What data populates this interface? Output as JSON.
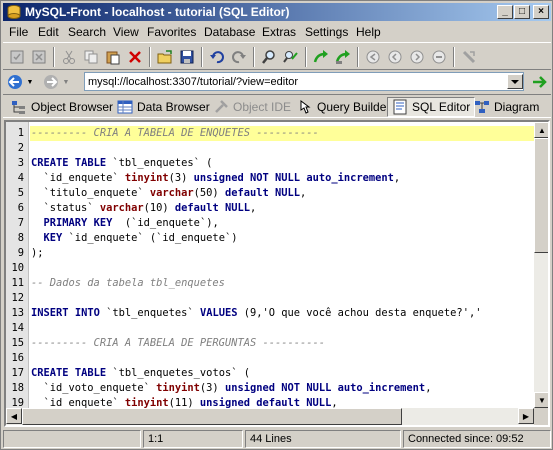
{
  "window": {
    "title": "MySQL-Front - localhost - tutorial  (SQL Editor)"
  },
  "menu": [
    "File",
    "Edit",
    "Search",
    "View",
    "Favorites",
    "Database",
    "Extras",
    "Settings",
    "Help"
  ],
  "address": {
    "value": "mysql://localhost:3307/tutorial/?view=editor"
  },
  "views": {
    "object_browser": "Object Browser",
    "data_browser": "Data Browser",
    "object_ide": "Object IDE",
    "query_builder": "Query Builder",
    "sql_editor": "SQL Editor",
    "diagram": "Diagram"
  },
  "editor": {
    "lines": [
      "--------- CRIA A TABELA DE ENQUETES ----------",
      "",
      "CREATE TABLE `tbl_enquetes` (",
      "  `id_enquete` tinyint(3) unsigned NOT NULL auto_increment,",
      "  `titulo_enquete` varchar(50) default NULL,",
      "  `status` varchar(10) default NULL,",
      "  PRIMARY KEY  (`id_enquete`),",
      "  KEY `id_enquete` (`id_enquete`)",
      ");",
      "",
      "-- Dados da tabela tbl_enquetes",
      "",
      "INSERT INTO `tbl_enquetes` VALUES (9,'O que você achou desta enquete?','",
      "",
      "--------- CRIA A TABELA DE PERGUNTAS ----------",
      "",
      "CREATE TABLE `tbl_enquetes_votos` (",
      "  `id_voto_enquete` tinyint(3) unsigned NOT NULL auto_increment,",
      "  `id_enquete` tinyint(11) unsigned default NULL,"
    ],
    "numbers": [
      "1",
      "2",
      "3",
      "4",
      "5",
      "6",
      "7",
      "8",
      "9",
      "10",
      "11",
      "12",
      "13",
      "14",
      "15",
      "16",
      "17",
      "18",
      "19"
    ]
  },
  "status": {
    "position": "1:1",
    "lines": "44 Lines",
    "connected": "Connected since: 09:52"
  },
  "colors": {
    "keyword": "#000080",
    "type": "#800000",
    "comment": "#808080",
    "highlight": "#ffff99"
  },
  "icons": [
    "app-icon",
    "new-icon",
    "close-icon",
    "cut-icon",
    "copy-icon",
    "paste-icon",
    "delete-icon",
    "open-icon",
    "save-icon",
    "undo-icon",
    "redo-icon",
    "find-icon",
    "replace-icon",
    "run-icon",
    "run-selection-icon",
    "first-icon",
    "prev-icon",
    "next-icon",
    "stop-icon",
    "back-icon",
    "forward-icon",
    "go-icon"
  ]
}
